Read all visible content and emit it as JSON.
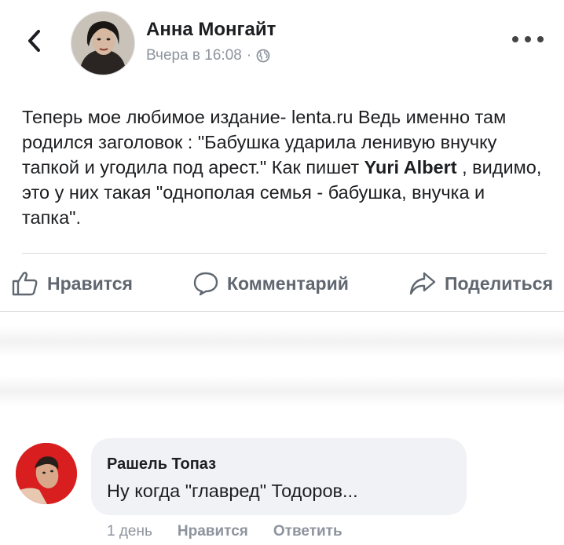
{
  "post": {
    "author": "Анна Монгайт",
    "time": "Вчера в 16:08",
    "separator": "·",
    "text_before": "Теперь мое любимое издание- lenta.ru Ведь именно там родился заголовок : \"Бабушка ударила ленивую внучку тапкой и угодила под арест.\"  Как пишет ",
    "mention": "Yuri Albert",
    "text_after": " , видимо, это у них такая \"однополая семья - бабушка, внучка и тапка\"."
  },
  "actions": {
    "like": "Нравится",
    "comment": "Комментарий",
    "share": "Поделиться"
  },
  "comment": {
    "author": "Рашель Топаз",
    "text": "Ну когда \"главред\" Тодоров...",
    "time": "1 день",
    "like": "Нравится",
    "reply": "Ответить"
  },
  "icons": {
    "back": "chevron-left-icon",
    "more": "more-dots-icon",
    "privacy": "globe-icon",
    "like": "thumbs-up-icon",
    "comment": "speech-bubble-icon",
    "share": "share-arrow-icon"
  },
  "colors": {
    "text": "#1c1e21",
    "secondary": "#8d949e",
    "action": "#606770",
    "bubble": "#f0f2f5",
    "divider": "#dadde1"
  }
}
